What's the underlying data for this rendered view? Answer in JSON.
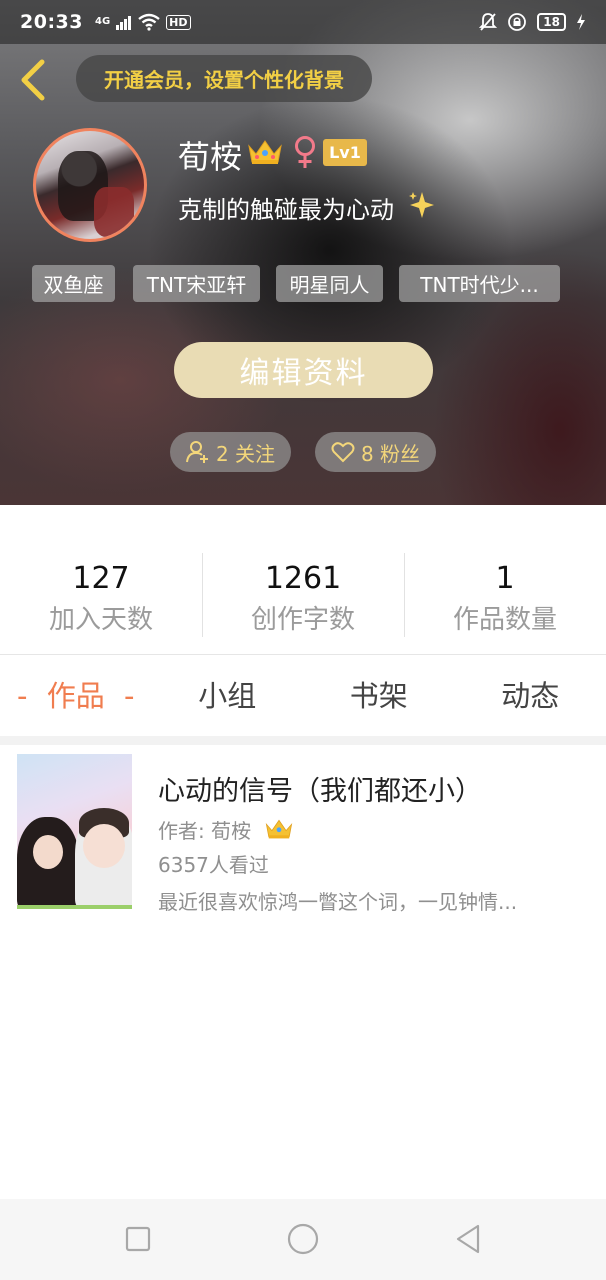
{
  "status_bar": {
    "time": "20:33",
    "network": "4G",
    "hd": "HD",
    "battery": "18"
  },
  "header": {
    "vip_banner": "开通会员，设置个性化背景"
  },
  "profile": {
    "username": "荀桉",
    "level": "Lv1",
    "bio": "克制的触碰最为心动",
    "tags": [
      "双鱼座",
      "TNT宋亚轩",
      "明星同人",
      "TNT时代少..."
    ],
    "edit_button": "编辑资料",
    "following": "2 关注",
    "fans": "8 粉丝",
    "colors": {
      "accent": "#f07d4f",
      "gold": "#f2cf45",
      "edit_button": "#e9dcb4"
    }
  },
  "stats": [
    {
      "value": "127",
      "label": "加入天数"
    },
    {
      "value": "1261",
      "label": "创作字数"
    },
    {
      "value": "1",
      "label": "作品数量"
    }
  ],
  "tabs": {
    "dash": "-",
    "items": [
      "作品",
      "小组",
      "书架",
      "动态"
    ],
    "active_index": 0
  },
  "work": {
    "title": "心动的信号（我们都还小）",
    "author_label": "作者: 荀桉",
    "views": "6357人看过",
    "description": "最近很喜欢惊鸿一瞥这个词，一见钟情..."
  },
  "icons": {
    "back": "chevron-left-icon",
    "crown": "crown-icon",
    "gender": "female-icon",
    "sparkle": "sparkle-icon",
    "follow": "person-plus-icon",
    "fans": "heart-icon",
    "nav": [
      "square-icon",
      "circle-icon",
      "triangle-back-icon"
    ]
  }
}
